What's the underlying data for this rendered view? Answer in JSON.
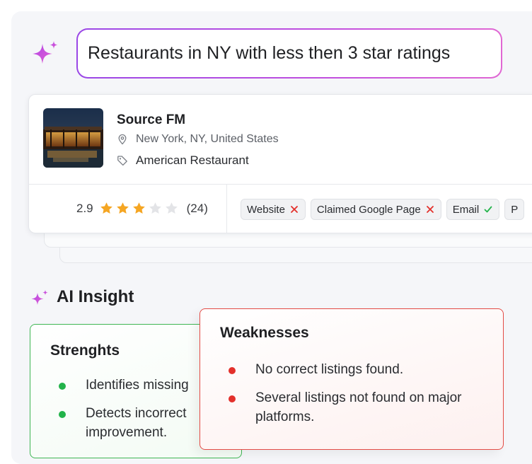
{
  "search": {
    "query": "Restaurants in NY with less then 3 star ratings"
  },
  "listing": {
    "name": "Source FM",
    "location": "New York, NY, United States",
    "category": "American Restaurant",
    "rating": "2.9",
    "stars_filled": 3,
    "stars_total": 5,
    "review_count": "(24)",
    "chips": [
      {
        "label": "Website",
        "status": "missing"
      },
      {
        "label": "Claimed Google Page",
        "status": "missing"
      },
      {
        "label": "Email",
        "status": "present"
      },
      {
        "label": "P",
        "status": "unknown"
      }
    ]
  },
  "insight": {
    "title": "AI Insight",
    "strengths": {
      "heading": "Strenghts",
      "items": [
        "Identifies missing",
        "Detects incorrect",
        "improvement."
      ]
    },
    "weaknesses": {
      "heading": "Weaknesses",
      "items": [
        "No correct listings found.",
        "Several listings not found on major platforms."
      ]
    }
  },
  "colors": {
    "accent_gradient_start": "#9a47e6",
    "accent_gradient_end": "#e067d3",
    "star": "#f5a623",
    "success": "#22b34a",
    "danger": "#e3302b"
  }
}
